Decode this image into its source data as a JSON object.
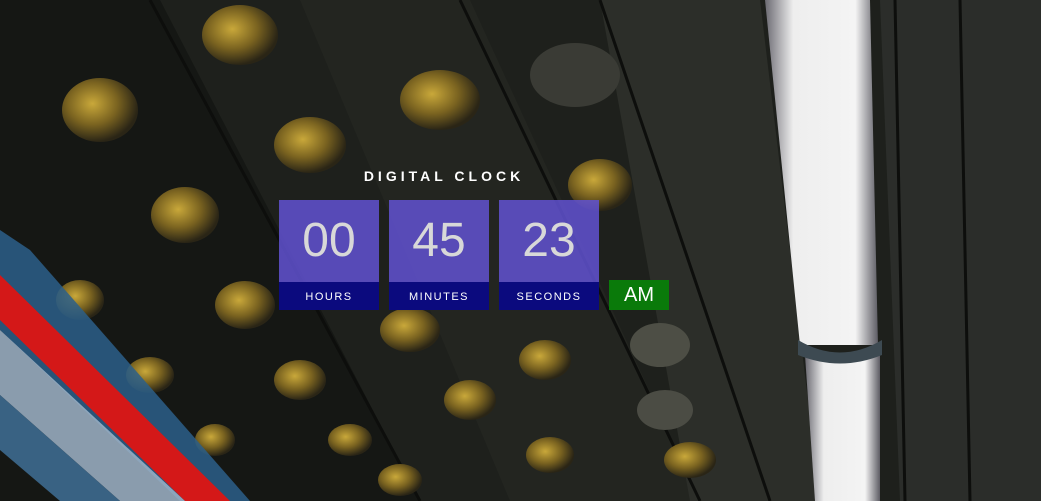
{
  "title": "DIGITAL CLOCK",
  "clock": {
    "hours": {
      "value": "00",
      "label": "HOURS"
    },
    "minutes": {
      "value": "45",
      "label": "MINUTES"
    },
    "seconds": {
      "value": "23",
      "label": "SECONDS"
    },
    "period": "AM"
  },
  "colors": {
    "digit_box": "#6252d2",
    "label_box": "#0b0a7e",
    "period_box": "#0a7a0a",
    "title_text": "#ffffff"
  }
}
